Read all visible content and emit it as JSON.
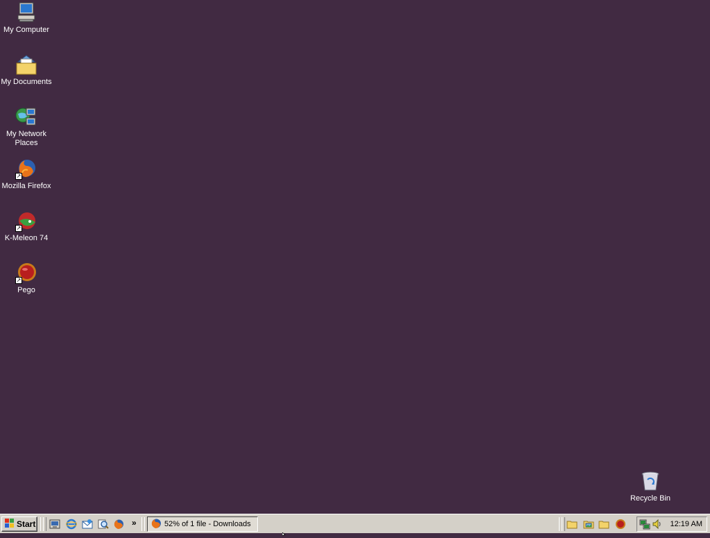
{
  "desktop": {
    "icons": [
      {
        "label": "My Computer",
        "icon": "computer-icon"
      },
      {
        "label": "My Documents",
        "icon": "documents-folder-icon"
      },
      {
        "label": "My Network Places",
        "icon": "network-places-icon"
      },
      {
        "label": "Mozilla Firefox",
        "icon": "firefox-icon"
      },
      {
        "label": "K-Meleon 74",
        "icon": "kmeleon-icon"
      },
      {
        "label": "Pego",
        "icon": "pego-icon"
      }
    ],
    "recycle_bin": {
      "label": "Recycle Bin",
      "icon": "recycle-bin-icon"
    }
  },
  "taskbar": {
    "start_label": "Start",
    "quick_launch": [
      "show-desktop-icon",
      "internet-explorer-icon",
      "outlook-express-icon",
      "search-icon",
      "firefox-icon"
    ],
    "overflow_label": "»",
    "task": {
      "label": "52% of 1 file - Downloads",
      "icon": "firefox-icon"
    },
    "toolbar_icons": [
      "folder-icon",
      "picture-folder-icon",
      "folder-icon",
      "pego-icon"
    ],
    "tray_icons": [
      "network-icon",
      "volume-icon"
    ],
    "clock": "12:19 AM"
  },
  "colors": {
    "desktop_bg": "#412a42",
    "taskbar_bg": "#d4d0c8"
  }
}
